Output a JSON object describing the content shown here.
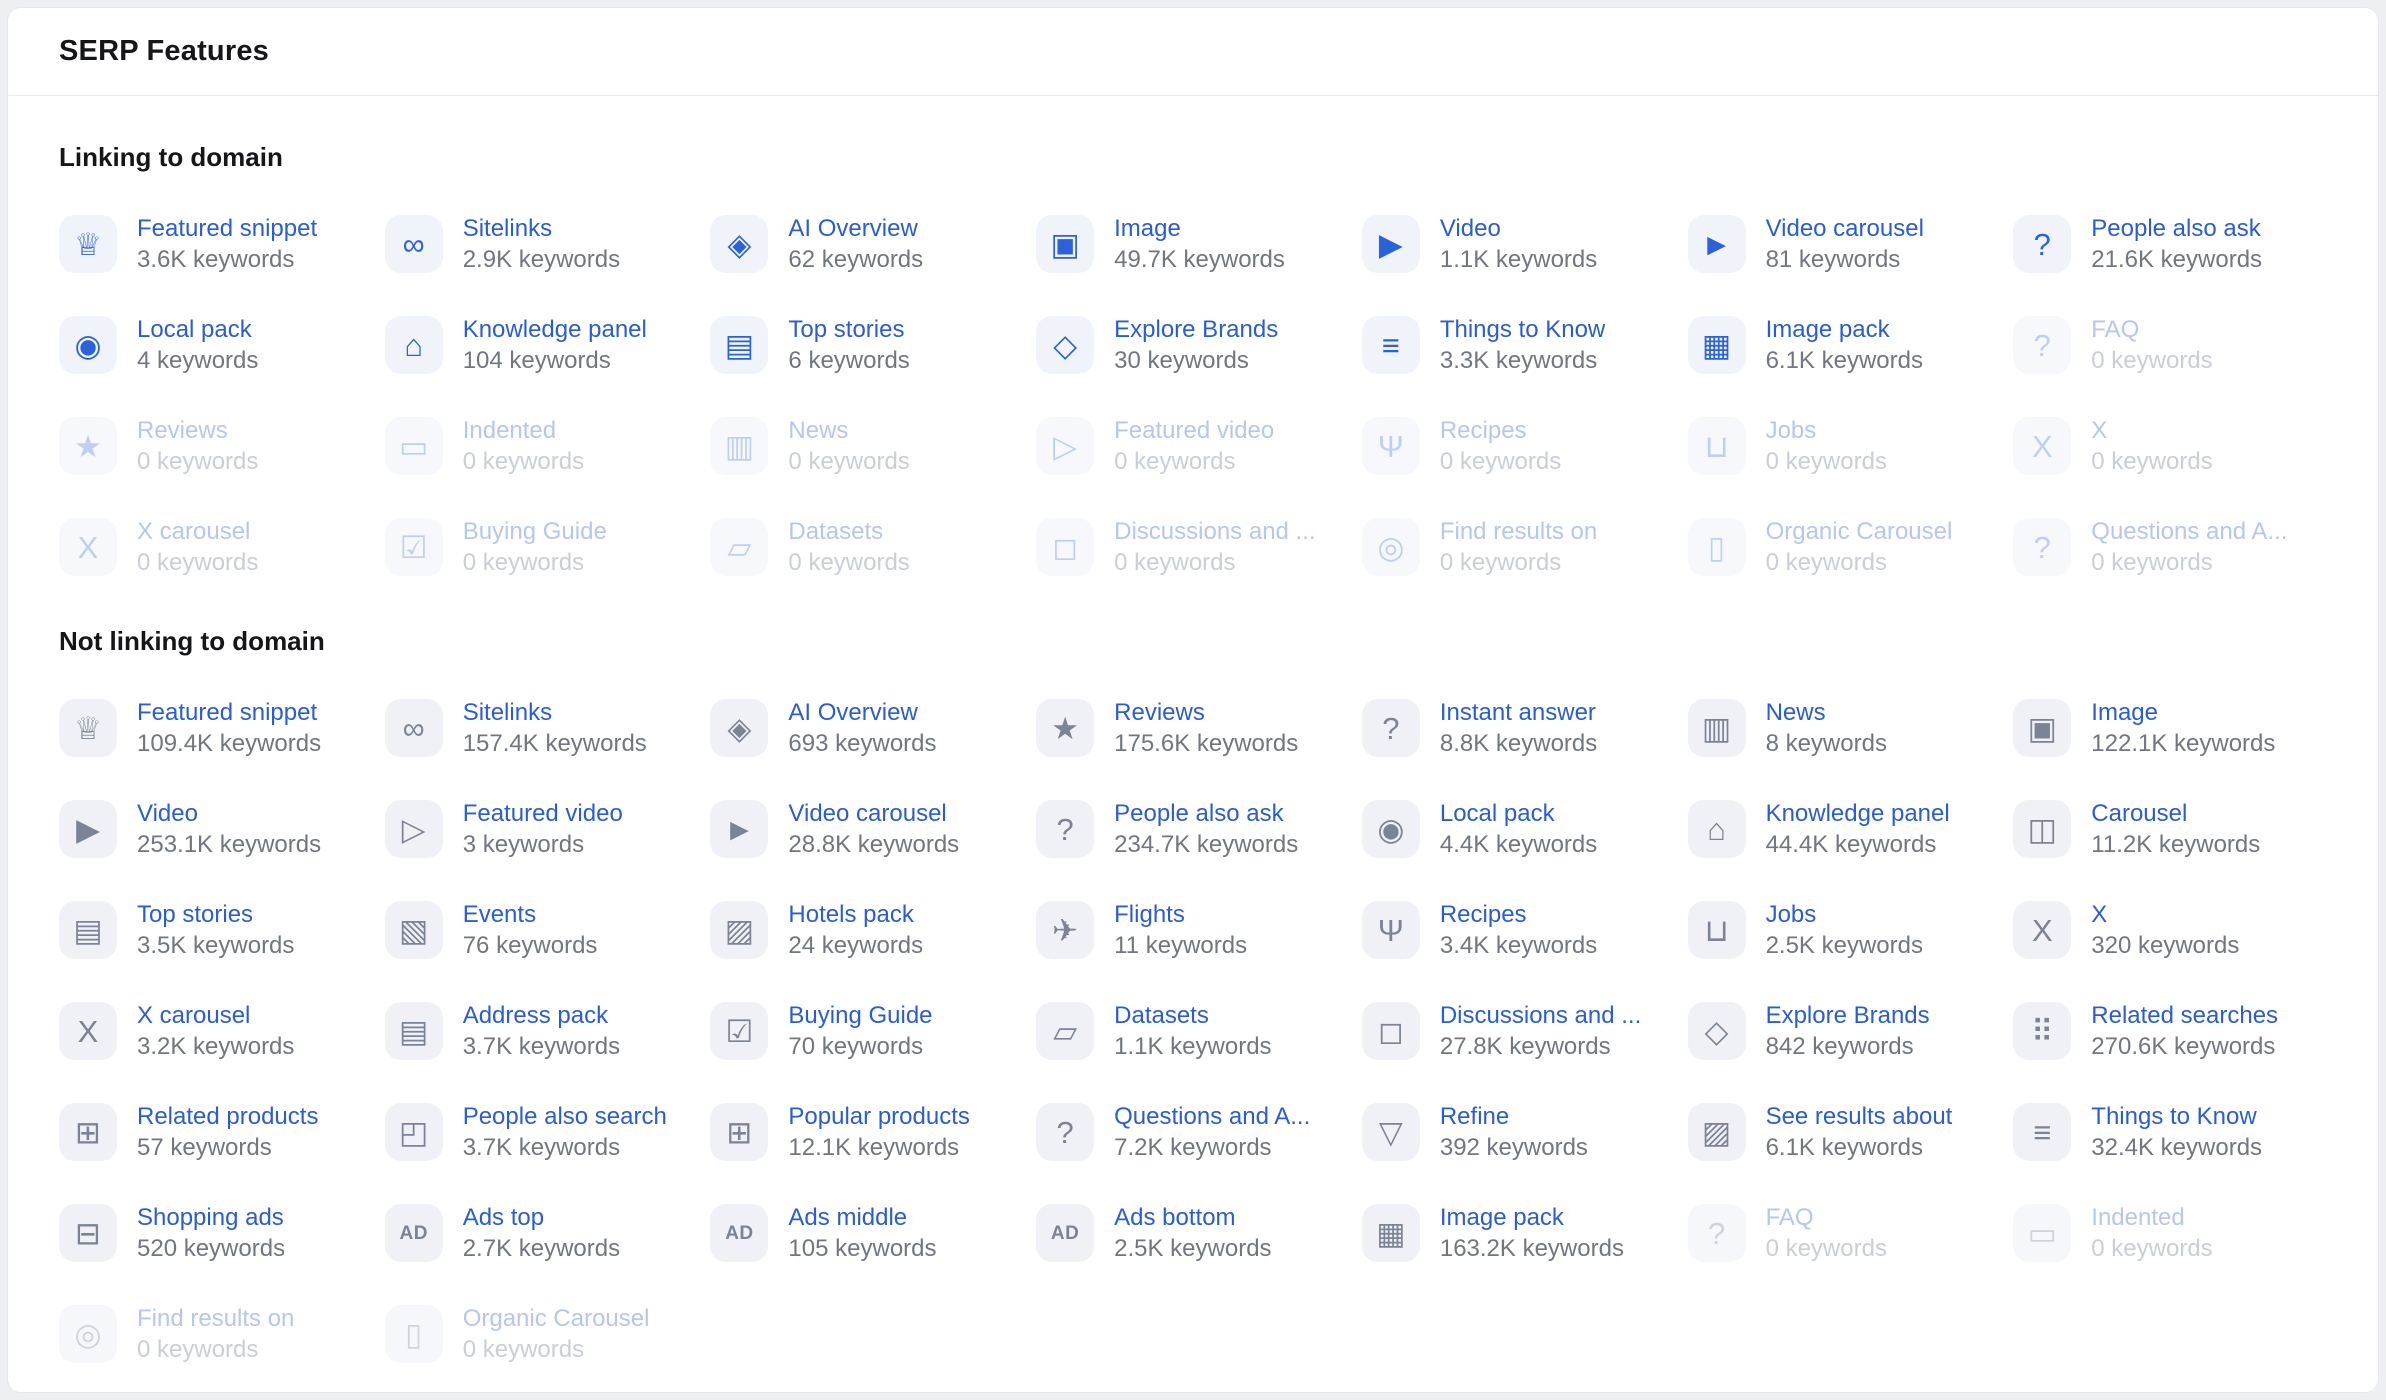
{
  "panel": {
    "title": "SERP Features"
  },
  "colors": {
    "link_blue": "#2a5cd7",
    "icon_blue": "#2b62da",
    "icon_gray": "#7b8494",
    "count_gray": "#71767f",
    "disabled_label_blue": "#b6c6ee",
    "disabled_count_gray": "#caced6",
    "icon_bg": "#f0f3f9",
    "panel_border": "#e6e8ed"
  },
  "icon_glyphs": {
    "crown-icon": "♕",
    "link-icon": "∞",
    "ai-sparkle-icon": "◈",
    "image-icon": "▣",
    "play-circle-icon": "▶",
    "play-carousel-icon": "►",
    "question-bubble-icon": "?",
    "map-pin-icon": "◉",
    "graduation-cap-icon": "⌂",
    "stacked-news-icon": "▤",
    "tag-icon": "◇",
    "list-icon": "≡",
    "image-pack-icon": "▦",
    "question-circle-icon": "?",
    "star-icon": "★",
    "indented-icon": "▭",
    "news-icon": "▥",
    "featured-video-icon": "▷",
    "utensils-icon": "Ψ",
    "briefcase-icon": "⊔",
    "x-icon": "X",
    "x-carousel-icon": "X",
    "checklist-icon": "☑",
    "folder-icon": "▱",
    "speech-bubble-icon": "◻",
    "search-check-icon": "◎",
    "organic-carousel-icon": "▯",
    "questions-answers-icon": "?",
    "instant-answer-icon": "?",
    "carousel-icon": "◫",
    "calendar-star-icon": "▧",
    "hotel-icon": "▨",
    "plane-icon": "✈",
    "address-pack-icon": "▤",
    "related-searches-icon": "⠿",
    "related-products-icon": "⊞",
    "people-also-search-icon": "◰",
    "popular-products-icon": "⊞",
    "funnel-icon": "▽",
    "see-results-icon": "▨",
    "shopping-cart-icon": "⊟",
    "ad-icon": "AD"
  },
  "sections": [
    {
      "id": "linking",
      "heading": "Linking to domain",
      "items": [
        {
          "label": "Featured snippet",
          "count": "3.6K keywords",
          "icon": "crown-icon",
          "disabled": false
        },
        {
          "label": "Sitelinks",
          "count": "2.9K keywords",
          "icon": "link-icon",
          "disabled": false
        },
        {
          "label": "AI Overview",
          "count": "62 keywords",
          "icon": "ai-sparkle-icon",
          "disabled": false
        },
        {
          "label": "Image",
          "count": "49.7K keywords",
          "icon": "image-icon",
          "disabled": false
        },
        {
          "label": "Video",
          "count": "1.1K keywords",
          "icon": "play-circle-icon",
          "disabled": false
        },
        {
          "label": "Video carousel",
          "count": "81 keywords",
          "icon": "play-carousel-icon",
          "disabled": false
        },
        {
          "label": "People also ask",
          "count": "21.6K keywords",
          "icon": "question-bubble-icon",
          "disabled": false
        },
        {
          "label": "Local pack",
          "count": "4 keywords",
          "icon": "map-pin-icon",
          "disabled": false
        },
        {
          "label": "Knowledge panel",
          "count": "104 keywords",
          "icon": "graduation-cap-icon",
          "disabled": false
        },
        {
          "label": "Top stories",
          "count": "6 keywords",
          "icon": "stacked-news-icon",
          "disabled": false
        },
        {
          "label": "Explore Brands",
          "count": "30 keywords",
          "icon": "tag-icon",
          "disabled": false
        },
        {
          "label": "Things to Know",
          "count": "3.3K keywords",
          "icon": "list-icon",
          "disabled": false
        },
        {
          "label": "Image pack",
          "count": "6.1K keywords",
          "icon": "image-pack-icon",
          "disabled": false
        },
        {
          "label": "FAQ",
          "count": "0 keywords",
          "icon": "question-circle-icon",
          "disabled": true
        },
        {
          "label": "Reviews",
          "count": "0 keywords",
          "icon": "star-icon",
          "disabled": true
        },
        {
          "label": "Indented",
          "count": "0 keywords",
          "icon": "indented-icon",
          "disabled": true
        },
        {
          "label": "News",
          "count": "0 keywords",
          "icon": "news-icon",
          "disabled": true
        },
        {
          "label": "Featured video",
          "count": "0 keywords",
          "icon": "featured-video-icon",
          "disabled": true
        },
        {
          "label": "Recipes",
          "count": "0 keywords",
          "icon": "utensils-icon",
          "disabled": true
        },
        {
          "label": "Jobs",
          "count": "0 keywords",
          "icon": "briefcase-icon",
          "disabled": true
        },
        {
          "label": "X",
          "count": "0 keywords",
          "icon": "x-icon",
          "disabled": true
        },
        {
          "label": "X carousel",
          "count": "0 keywords",
          "icon": "x-carousel-icon",
          "disabled": true
        },
        {
          "label": "Buying Guide",
          "count": "0 keywords",
          "icon": "checklist-icon",
          "disabled": true
        },
        {
          "label": "Datasets",
          "count": "0 keywords",
          "icon": "folder-icon",
          "disabled": true
        },
        {
          "label": "Discussions and ...",
          "count": "0 keywords",
          "icon": "speech-bubble-icon",
          "disabled": true
        },
        {
          "label": "Find results on",
          "count": "0 keywords",
          "icon": "search-check-icon",
          "disabled": true
        },
        {
          "label": "Organic Carousel",
          "count": "0 keywords",
          "icon": "organic-carousel-icon",
          "disabled": true
        },
        {
          "label": "Questions and A...",
          "count": "0 keywords",
          "icon": "questions-answers-icon",
          "disabled": true
        }
      ]
    },
    {
      "id": "not-linking",
      "heading": "Not linking to domain",
      "items": [
        {
          "label": "Featured snippet",
          "count": "109.4K keywords",
          "icon": "crown-icon",
          "disabled": false
        },
        {
          "label": "Sitelinks",
          "count": "157.4K keywords",
          "icon": "link-icon",
          "disabled": false
        },
        {
          "label": "AI Overview",
          "count": "693 keywords",
          "icon": "ai-sparkle-icon",
          "disabled": false
        },
        {
          "label": "Reviews",
          "count": "175.6K keywords",
          "icon": "star-icon",
          "disabled": false
        },
        {
          "label": "Instant answer",
          "count": "8.8K keywords",
          "icon": "instant-answer-icon",
          "disabled": false
        },
        {
          "label": "News",
          "count": "8 keywords",
          "icon": "news-icon",
          "disabled": false
        },
        {
          "label": "Image",
          "count": "122.1K keywords",
          "icon": "image-icon",
          "disabled": false
        },
        {
          "label": "Video",
          "count": "253.1K keywords",
          "icon": "play-circle-icon",
          "disabled": false
        },
        {
          "label": "Featured video",
          "count": "3 keywords",
          "icon": "featured-video-icon",
          "disabled": false
        },
        {
          "label": "Video carousel",
          "count": "28.8K keywords",
          "icon": "play-carousel-icon",
          "disabled": false
        },
        {
          "label": "People also ask",
          "count": "234.7K keywords",
          "icon": "question-bubble-icon",
          "disabled": false
        },
        {
          "label": "Local pack",
          "count": "4.4K keywords",
          "icon": "map-pin-icon",
          "disabled": false
        },
        {
          "label": "Knowledge panel",
          "count": "44.4K keywords",
          "icon": "graduation-cap-icon",
          "disabled": false
        },
        {
          "label": "Carousel",
          "count": "11.2K keywords",
          "icon": "carousel-icon",
          "disabled": false
        },
        {
          "label": "Top stories",
          "count": "3.5K keywords",
          "icon": "stacked-news-icon",
          "disabled": false
        },
        {
          "label": "Events",
          "count": "76 keywords",
          "icon": "calendar-star-icon",
          "disabled": false
        },
        {
          "label": "Hotels pack",
          "count": "24 keywords",
          "icon": "hotel-icon",
          "disabled": false
        },
        {
          "label": "Flights",
          "count": "11 keywords",
          "icon": "plane-icon",
          "disabled": false
        },
        {
          "label": "Recipes",
          "count": "3.4K keywords",
          "icon": "utensils-icon",
          "disabled": false
        },
        {
          "label": "Jobs",
          "count": "2.5K keywords",
          "icon": "briefcase-icon",
          "disabled": false
        },
        {
          "label": "X",
          "count": "320 keywords",
          "icon": "x-icon",
          "disabled": false
        },
        {
          "label": "X carousel",
          "count": "3.2K keywords",
          "icon": "x-carousel-icon",
          "disabled": false
        },
        {
          "label": "Address pack",
          "count": "3.7K keywords",
          "icon": "address-pack-icon",
          "disabled": false
        },
        {
          "label": "Buying Guide",
          "count": "70 keywords",
          "icon": "checklist-icon",
          "disabled": false
        },
        {
          "label": "Datasets",
          "count": "1.1K keywords",
          "icon": "folder-icon",
          "disabled": false
        },
        {
          "label": "Discussions and ...",
          "count": "27.8K keywords",
          "icon": "speech-bubble-icon",
          "disabled": false
        },
        {
          "label": "Explore Brands",
          "count": "842 keywords",
          "icon": "tag-icon",
          "disabled": false
        },
        {
          "label": "Related searches",
          "count": "270.6K keywords",
          "icon": "related-searches-icon",
          "disabled": false
        },
        {
          "label": "Related products",
          "count": "57 keywords",
          "icon": "related-products-icon",
          "disabled": false
        },
        {
          "label": "People also search",
          "count": "3.7K keywords",
          "icon": "people-also-search-icon",
          "disabled": false
        },
        {
          "label": "Popular products",
          "count": "12.1K keywords",
          "icon": "popular-products-icon",
          "disabled": false
        },
        {
          "label": "Questions and A...",
          "count": "7.2K keywords",
          "icon": "questions-answers-icon",
          "disabled": false
        },
        {
          "label": "Refine",
          "count": "392 keywords",
          "icon": "funnel-icon",
          "disabled": false
        },
        {
          "label": "See results about",
          "count": "6.1K keywords",
          "icon": "see-results-icon",
          "disabled": false
        },
        {
          "label": "Things to Know",
          "count": "32.4K keywords",
          "icon": "list-icon",
          "disabled": false
        },
        {
          "label": "Shopping ads",
          "count": "520 keywords",
          "icon": "shopping-cart-icon",
          "disabled": false
        },
        {
          "label": "Ads top",
          "count": "2.7K keywords",
          "icon": "ad-icon",
          "disabled": false
        },
        {
          "label": "Ads middle",
          "count": "105 keywords",
          "icon": "ad-icon",
          "disabled": false
        },
        {
          "label": "Ads bottom",
          "count": "2.5K keywords",
          "icon": "ad-icon",
          "disabled": false
        },
        {
          "label": "Image pack",
          "count": "163.2K keywords",
          "icon": "image-pack-icon",
          "disabled": false
        },
        {
          "label": "FAQ",
          "count": "0 keywords",
          "icon": "question-circle-icon",
          "disabled": true
        },
        {
          "label": "Indented",
          "count": "0 keywords",
          "icon": "indented-icon",
          "disabled": true
        },
        {
          "label": "Find results on",
          "count": "0 keywords",
          "icon": "search-check-icon",
          "disabled": true
        },
        {
          "label": "Organic Carousel",
          "count": "0 keywords",
          "icon": "organic-carousel-icon",
          "disabled": true
        }
      ]
    }
  ]
}
